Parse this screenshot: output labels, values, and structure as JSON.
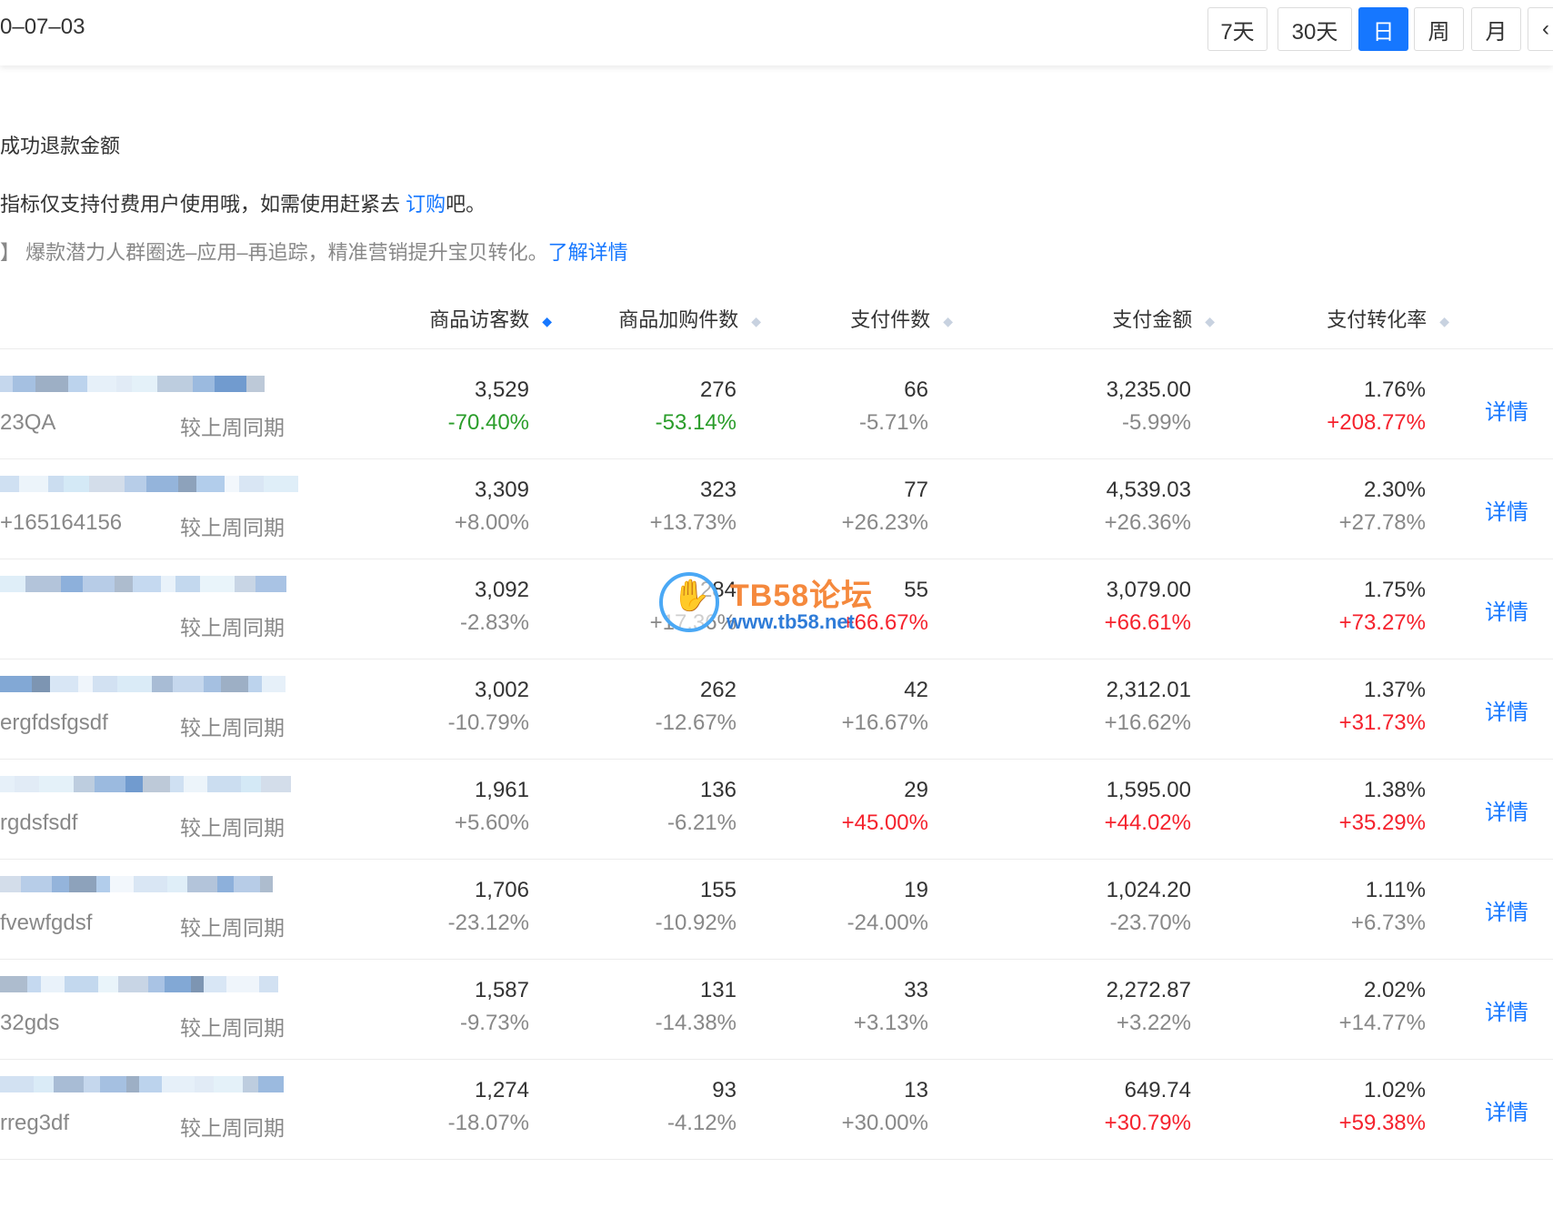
{
  "toolbar": {
    "date": "0–07–03",
    "buttons": [
      {
        "label": "7天",
        "active": false
      },
      {
        "label": "30天",
        "active": false
      },
      {
        "label": "日",
        "active": true
      },
      {
        "label": "周",
        "active": false
      },
      {
        "label": "月",
        "active": false
      },
      {
        "label": "‹",
        "active": false
      }
    ]
  },
  "notices": {
    "metric_label": "成功退款金额",
    "paid_prefix": "指标仅支持付费用户使用哦，如需使用赶紧去 ",
    "paid_link": "订购",
    "paid_suffix": "吧。",
    "promo_text": "】 爆款潜力人群圈选–应用–再追踪，精准营销提升宝贝转化。",
    "promo_link": "了解详情"
  },
  "columns": [
    "商品访客数",
    "商品加购件数",
    "支付件数",
    "支付金额",
    "支付转化率"
  ],
  "compare_label": "较上周同期",
  "detail_label": "详情",
  "rows": [
    {
      "id": "23QA",
      "values": [
        "3,529",
        "276",
        "66",
        "3,235.00",
        "1.76%"
      ],
      "changes": [
        "-70.40%",
        "-53.14%",
        "-5.71%",
        "-5.99%",
        "+208.77%"
      ]
    },
    {
      "id": "+165164156",
      "values": [
        "3,309",
        "323",
        "77",
        "4,539.03",
        "2.30%"
      ],
      "changes": [
        "+8.00%",
        "+13.73%",
        "+26.23%",
        "+26.36%",
        "+27.78%"
      ]
    },
    {
      "id": "",
      "values": [
        "3,092",
        "284",
        "55",
        "3,079.00",
        "1.75%"
      ],
      "changes": [
        "-2.83%",
        "+17.36%",
        "+66.67%",
        "+66.61%",
        "+73.27%"
      ]
    },
    {
      "id": "ergfdsfgsdf",
      "values": [
        "3,002",
        "262",
        "42",
        "2,312.01",
        "1.37%"
      ],
      "changes": [
        "-10.79%",
        "-12.67%",
        "+16.67%",
        "+16.62%",
        "+31.73%"
      ]
    },
    {
      "id": "rgdsfsdf",
      "values": [
        "1,961",
        "136",
        "29",
        "1,595.00",
        "1.38%"
      ],
      "changes": [
        "+5.60%",
        "-6.21%",
        "+45.00%",
        "+44.02%",
        "+35.29%"
      ]
    },
    {
      "id": "fvewfgdsf",
      "values": [
        "1,706",
        "155",
        "19",
        "1,024.20",
        "1.11%"
      ],
      "changes": [
        "-23.12%",
        "-10.92%",
        "-24.00%",
        "-23.70%",
        "+6.73%"
      ]
    },
    {
      "id": "32gds",
      "values": [
        "1,587",
        "131",
        "33",
        "2,272.87",
        "2.02%"
      ],
      "changes": [
        "-9.73%",
        "-14.38%",
        "+3.13%",
        "+3.22%",
        "+14.77%"
      ]
    },
    {
      "id": "rreg3df",
      "values": [
        "1,274",
        "93",
        "13",
        "649.74",
        "1.02%"
      ],
      "changes": [
        "-18.07%",
        "-4.12%",
        "+30.00%",
        "+30.79%",
        "+59.38%"
      ]
    }
  ],
  "change_colors": {
    "0": [
      "green",
      "green",
      "neutral",
      "neutral",
      "red"
    ],
    "1": [
      "neutral",
      "neutral",
      "neutral",
      "neutral",
      "neutral"
    ],
    "2": [
      "neutral",
      "neutral",
      "red",
      "red",
      "red"
    ],
    "3": [
      "neutral",
      "neutral",
      "neutral",
      "neutral",
      "red"
    ],
    "4": [
      "neutral",
      "neutral",
      "red",
      "red",
      "red"
    ],
    "5": [
      "neutral",
      "neutral",
      "neutral",
      "neutral",
      "neutral"
    ],
    "6": [
      "neutral",
      "neutral",
      "neutral",
      "neutral",
      "neutral"
    ],
    "7": [
      "neutral",
      "neutral",
      "neutral",
      "red",
      "red"
    ]
  },
  "colors": {
    "accent": "#1677ff",
    "red": "#f5222d",
    "green": "#2a9d2a",
    "muted": "#888888"
  },
  "watermark": {
    "title": "TB58论坛",
    "url": "www.tb58.net"
  }
}
